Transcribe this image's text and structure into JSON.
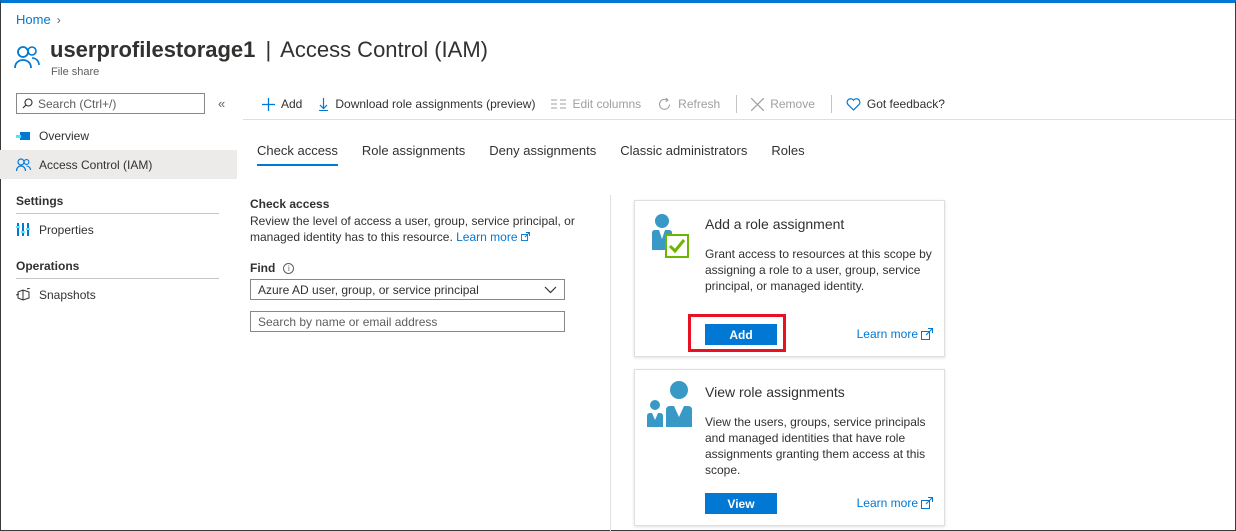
{
  "breadcrumb": {
    "home": "Home"
  },
  "header": {
    "resource_name": "userprofilestorage1",
    "separator": "|",
    "blade_title": "Access Control (IAM)",
    "resource_type": "File share"
  },
  "sidebar": {
    "search_placeholder": "Search (Ctrl+/)",
    "items": [
      {
        "label": "Overview"
      },
      {
        "label": "Access Control (IAM)"
      }
    ],
    "sections": [
      {
        "title": "Settings",
        "items": [
          {
            "label": "Properties"
          }
        ]
      },
      {
        "title": "Operations",
        "items": [
          {
            "label": "Snapshots"
          }
        ]
      }
    ]
  },
  "toolbar": {
    "add": "Add",
    "download": "Download role assignments (preview)",
    "edit_columns": "Edit columns",
    "refresh": "Refresh",
    "remove": "Remove",
    "feedback": "Got feedback?"
  },
  "tabs": [
    "Check access",
    "Role assignments",
    "Deny assignments",
    "Classic administrators",
    "Roles"
  ],
  "check_access": {
    "title": "Check access",
    "description": "Review the level of access a user, group, service principal, or managed identity has to this resource.",
    "learn_more": "Learn more",
    "find_label": "Find",
    "find_selected": "Azure AD user, group, or service principal",
    "search_placeholder": "Search by name or email address"
  },
  "cards": {
    "add_role": {
      "title": "Add a role assignment",
      "description": "Grant access to resources at this scope by assigning a role to a user, group, service principal, or managed identity.",
      "button": "Add",
      "learn_more": "Learn more"
    },
    "view_role": {
      "title": "View role assignments",
      "description": "View the users, groups, service principals and managed identities that have role assignments granting them access at this scope.",
      "button": "View",
      "learn_more": "Learn more"
    }
  },
  "colors": {
    "accent": "#0078d4",
    "highlight": "#e81123",
    "check": "#6bb700"
  }
}
